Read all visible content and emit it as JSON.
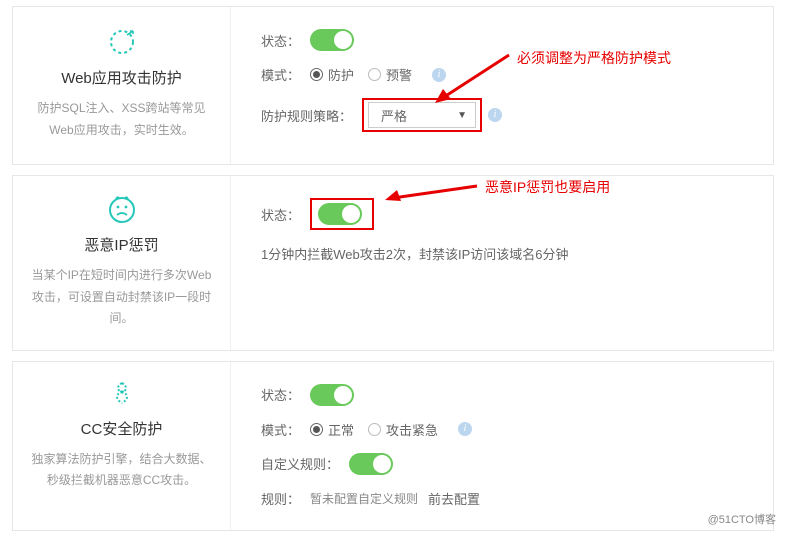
{
  "panels": {
    "web": {
      "title": "Web应用攻击防护",
      "desc": "防护SQL注入、XSS跨站等常见Web应用攻击，实时生效。",
      "status_label": "状态：",
      "mode_label": "模式：",
      "mode_opt1": "防护",
      "mode_opt2": "预警",
      "rule_label": "防护规则策略：",
      "rule_value": "严格",
      "annot": "必须调整为严格防护模式"
    },
    "ip": {
      "title": "恶意IP惩罚",
      "desc": "当某个IP在短时间内进行多次Web攻击，可设置自动封禁该IP一段时间。",
      "status_label": "状态：",
      "rule_text": "1分钟内拦截Web攻击2次，封禁该IP访问该域名6分钟",
      "annot": "恶意IP惩罚也要启用"
    },
    "cc": {
      "title": "CC安全防护",
      "desc": "独家算法防护引擎，结合大数据、秒级拦截机器恶意CC攻击。",
      "status_label": "状态：",
      "mode_label": "模式：",
      "mode_opt1": "正常",
      "mode_opt2": "攻击紧急",
      "custom_label": "自定义规则：",
      "rules_label": "规则：",
      "rules_value": "暂未配置自定义规则",
      "rules_link": "前去配置"
    }
  },
  "watermark": "@51CTO博客"
}
